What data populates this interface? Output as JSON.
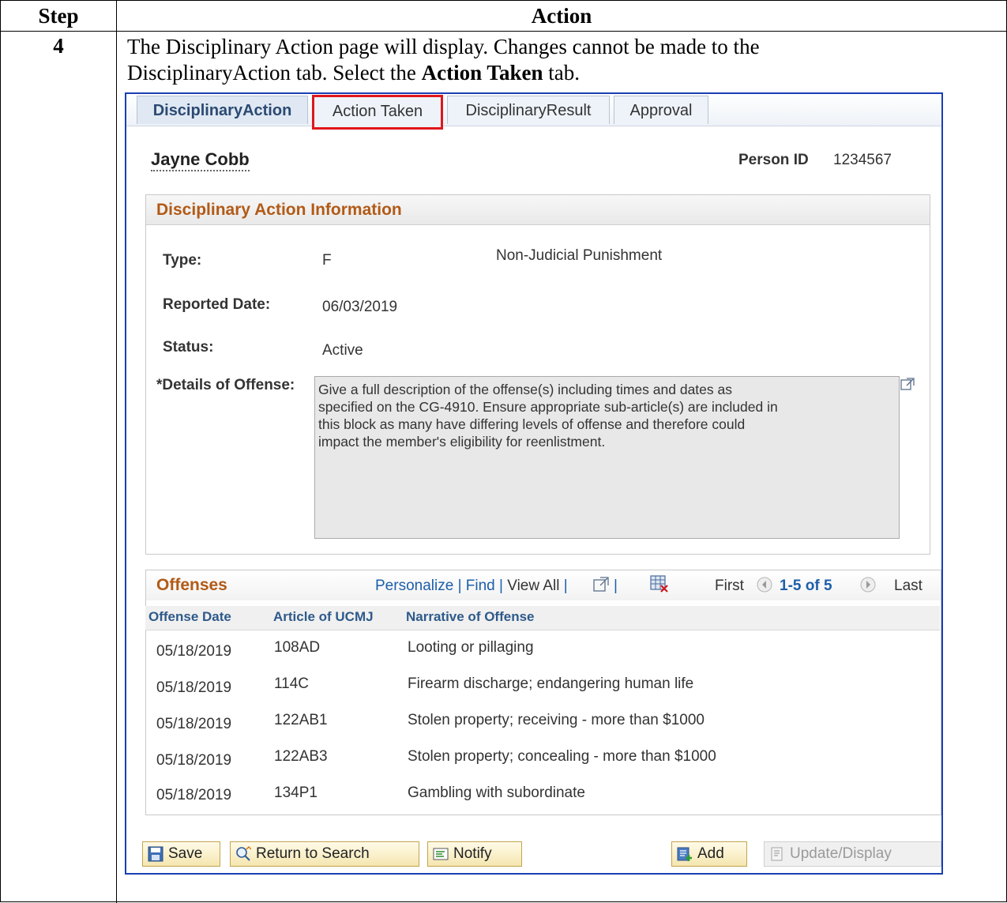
{
  "document": {
    "header_step": "Step",
    "header_action": "Action",
    "step_number": "4",
    "instruction": {
      "line1": "The Disciplinary Action page will display.  Changes cannot be made to the",
      "line2_prefix": "DisciplinaryAction tab.  Select the ",
      "line2_bold": "Action Taken",
      "line2_suffix": " tab."
    }
  },
  "tabs": [
    {
      "label": "DisciplinaryAction",
      "state": "active"
    },
    {
      "label": "Action Taken",
      "state": "highlighted"
    },
    {
      "label": "DisciplinaryResult",
      "state": "normal"
    },
    {
      "label": "Approval",
      "state": "normal"
    }
  ],
  "person": {
    "name": "Jayne Cobb",
    "id_label": "Person ID",
    "id_value": "1234567"
  },
  "disciplinary_info": {
    "section_title": "Disciplinary Action Information",
    "type_label": "Type:",
    "type_code": "F",
    "type_description": "Non-Judicial Punishment",
    "reported_date_label": "Reported Date:",
    "reported_date": "06/03/2019",
    "status_label": "Status:",
    "status": "Active",
    "details_label": "*Details of Offense:",
    "details_lines": [
      "Give a full description of the offense(s) including times and dates as",
      "specified on the CG-4910.  Ensure appropriate sub-article(s) are included in",
      "this block as many have differing levels of offense and therefore could",
      "impact the member's eligibility for reenlistment."
    ]
  },
  "offenses": {
    "section_title": "Offenses",
    "toolbar": {
      "personalize": "Personalize",
      "sep": "|",
      "find": "Find",
      "view_all": "View All",
      "first": "First",
      "range": "1-5 of 5",
      "last": "Last"
    },
    "columns": [
      "Offense Date",
      "Article of UCMJ",
      "Narrative of Offense"
    ],
    "rows": [
      {
        "date": "05/18/2019",
        "article": "108AD",
        "narrative": "Looting or pillaging"
      },
      {
        "date": "05/18/2019",
        "article": "114C",
        "narrative": "Firearm discharge; endangering human life"
      },
      {
        "date": "05/18/2019",
        "article": "122AB1",
        "narrative": "Stolen property; receiving - more than $1000"
      },
      {
        "date": "05/18/2019",
        "article": "122AB3",
        "narrative": "Stolen property; concealing - more than $1000"
      },
      {
        "date": "05/18/2019",
        "article": "134P1",
        "narrative": "Gambling with subordinate"
      }
    ]
  },
  "buttons": {
    "save": "Save",
    "return_to_search": "Return to Search",
    "notify": "Notify",
    "add": "Add",
    "update_display": "Update/Display"
  },
  "colors": {
    "frame_border": "#1a3fb5",
    "highlight": "#e0161b",
    "section_title": "#b25a16",
    "link": "#1d5faa"
  }
}
